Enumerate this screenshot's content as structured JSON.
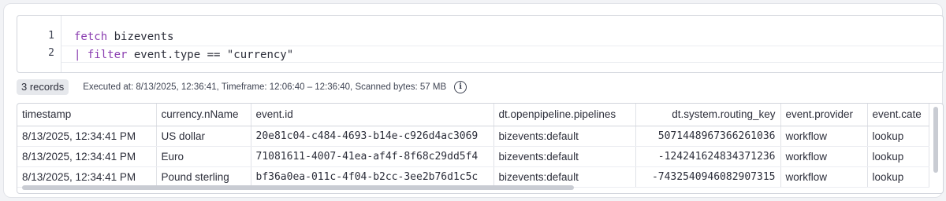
{
  "editor": {
    "lines": [
      {
        "number": "1",
        "keyword": "fetch",
        "rest": " bizevents"
      },
      {
        "number": "2",
        "pipe": "| ",
        "keyword": "filter",
        "rest": " event.type == \"currency\""
      }
    ]
  },
  "status": {
    "records": "3 records",
    "executed": "Executed at: 8/13/2025, 12:36:41, Timeframe: 12:06:40 – 12:36:40, Scanned bytes: 57 MB",
    "info_icon": "i"
  },
  "table": {
    "columns": [
      "timestamp",
      "currency.nName",
      "event.id",
      "dt.openpipeline.pipelines",
      "dt.system.routing_key",
      "event.provider",
      "event.cate"
    ],
    "rows": [
      [
        "8/13/2025, 12:34:41 PM",
        "US dollar",
        "20e81c04-c484-4693-b14e-c926d4ac3069",
        "bizevents:default",
        "5071448967366261036",
        "workflow",
        "lookup"
      ],
      [
        "8/13/2025, 12:34:41 PM",
        "Euro",
        "71081611-4007-41ea-af4f-8f68c29dd5f4",
        "bizevents:default",
        "-124241624834371236",
        "workflow",
        "lookup"
      ],
      [
        "8/13/2025, 12:34:41 PM",
        "Pound sterling",
        "bf36a0ea-011c-4f04-b2cc-3ee2b76d1c5c",
        "bizevents:default",
        "-7432540946082907315",
        "workflow",
        "lookup"
      ]
    ]
  }
}
